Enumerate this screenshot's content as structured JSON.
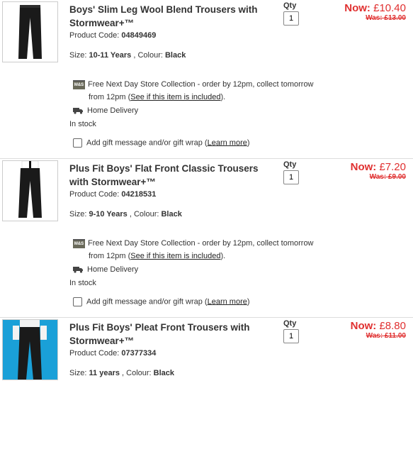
{
  "items": [
    {
      "title": "Boys' Slim Leg Wool Blend Trousers with Stormwear+™",
      "code_label": "Product Code:",
      "code": "04849469",
      "size_label": "Size:",
      "size": "10-11 Years",
      "colour_label": ", Colour:",
      "colour": "Black",
      "qty_label": "Qty",
      "qty": "1",
      "now_label": "Now:",
      "now_price": "£10.40",
      "was": "Was: £13.00",
      "collect_text": "Free Next Day Store Collection - order by 12pm, collect tomorrow",
      "collect_text2": "from 12pm (",
      "collect_link": "See if this item is included",
      "collect_end": ").",
      "home_delivery": "Home Delivery",
      "stock": "In stock",
      "gift_text": "Add gift message and/or gift wrap (",
      "gift_link": "Learn more",
      "gift_end": ")"
    },
    {
      "title": "Plus Fit Boys' Flat Front Classic Trousers with Stormwear+™",
      "code_label": "Product Code:",
      "code": "04218531",
      "size_label": "Size:",
      "size": "9-10 Years",
      "colour_label": ", Colour:",
      "colour": "Black",
      "qty_label": "Qty",
      "qty": "1",
      "now_label": "Now:",
      "now_price": "£7.20",
      "was": "Was: £9.00",
      "collect_text": "Free Next Day Store Collection - order by 12pm, collect tomorrow",
      "collect_text2": "from 12pm (",
      "collect_link": "See if this item is included",
      "collect_end": ").",
      "home_delivery": "Home Delivery",
      "stock": "In stock",
      "gift_text": "Add gift message and/or gift wrap (",
      "gift_link": "Learn more",
      "gift_end": ")"
    },
    {
      "title": "Plus Fit Boys' Pleat Front Trousers with Stormwear+™",
      "code_label": "Product Code:",
      "code": "07377334",
      "size_label": "Size:",
      "size": "11 years",
      "colour_label": ", Colour:",
      "colour": "Black",
      "qty_label": "Qty",
      "qty": "1",
      "now_label": "Now:",
      "now_price": "£8.80",
      "was": "Was: £11.00"
    }
  ],
  "store_badge": "M&S",
  "colors": {
    "price": "#e03030",
    "text": "#333333"
  }
}
